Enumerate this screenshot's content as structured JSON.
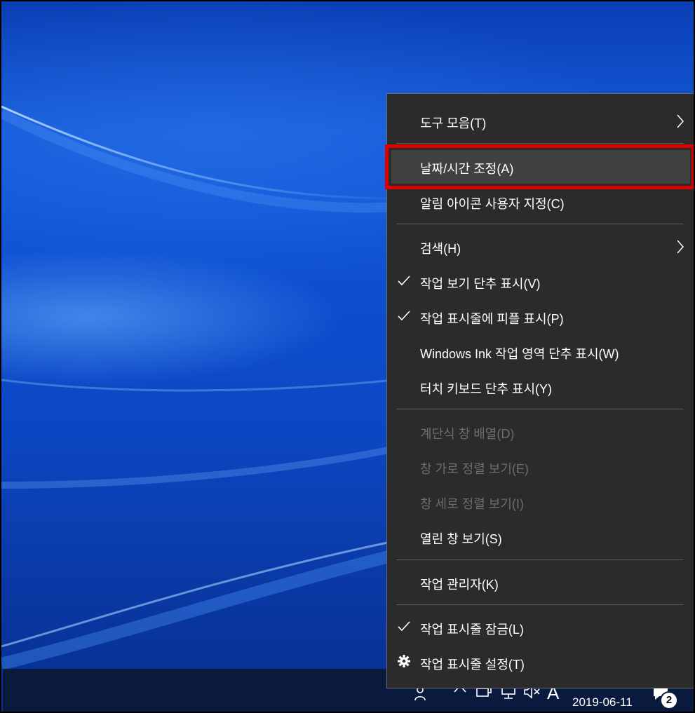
{
  "menu": {
    "items": [
      {
        "label": "도구 모음(T)",
        "submenu": true,
        "checked": false,
        "enabled": true
      },
      {
        "label": "날짜/시간 조정(A)",
        "submenu": false,
        "checked": false,
        "enabled": true,
        "highlighted": true
      },
      {
        "label": "알림 아이콘 사용자 지정(C)",
        "submenu": false,
        "checked": false,
        "enabled": true
      },
      {
        "label": "검색(H)",
        "submenu": true,
        "checked": false,
        "enabled": true
      },
      {
        "label": "작업 보기 단추 표시(V)",
        "submenu": false,
        "checked": true,
        "enabled": true
      },
      {
        "label": "작업 표시줄에 피플 표시(P)",
        "submenu": false,
        "checked": true,
        "enabled": true
      },
      {
        "label": "Windows Ink 작업 영역 단추 표시(W)",
        "submenu": false,
        "checked": false,
        "enabled": true
      },
      {
        "label": "터치 키보드 단추 표시(Y)",
        "submenu": false,
        "checked": false,
        "enabled": true
      },
      {
        "label": "계단식 창 배열(D)",
        "submenu": false,
        "checked": false,
        "enabled": false
      },
      {
        "label": "창 가로 정렬 보기(E)",
        "submenu": false,
        "checked": false,
        "enabled": false
      },
      {
        "label": "창 세로 정렬 보기(I)",
        "submenu": false,
        "checked": false,
        "enabled": false
      },
      {
        "label": "열린 창 보기(S)",
        "submenu": false,
        "checked": false,
        "enabled": true
      },
      {
        "label": "작업 관리자(K)",
        "submenu": false,
        "checked": false,
        "enabled": true
      },
      {
        "label": "작업 표시줄 잠금(L)",
        "submenu": false,
        "checked": true,
        "enabled": true
      },
      {
        "label": "작업 표시줄 설정(T)",
        "submenu": false,
        "checked": false,
        "enabled": true,
        "icon": "gear-icon"
      }
    ]
  },
  "taskbar": {
    "clock_date": "2019-06-11",
    "ime_label": "A",
    "notification_count": "2",
    "tray_icons": [
      "people-icon",
      "chevron-up-icon",
      "network-icon",
      "display-icon",
      "volume-muted-icon"
    ]
  },
  "colors": {
    "menu_bg": "#2b2b2b",
    "menu_hover": "#414141",
    "highlight_box": "#e10000",
    "disabled_text": "#6d6d6d"
  }
}
